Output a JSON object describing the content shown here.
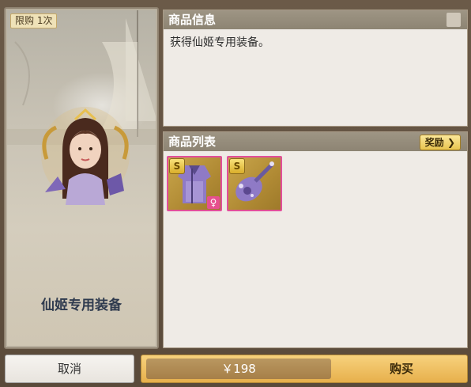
{
  "card": {
    "limit_tag": "限购 1次",
    "title": "仙姬专用装备"
  },
  "info_panel": {
    "header": "商品信息",
    "description": "获得仙姬专用装备。"
  },
  "list_panel": {
    "header": "商品列表",
    "reward_button": "奖励 ❯",
    "items": [
      {
        "icon": "robe-icon",
        "badge": "S",
        "gender_icon": "♀"
      },
      {
        "icon": "guitar-icon",
        "badge": "S"
      }
    ]
  },
  "footer": {
    "cancel_label": "取消",
    "price": "￥198",
    "buy_label": "购买"
  },
  "colors": {
    "item_border": "#e24e9a",
    "buy_button": "#e7b04c",
    "panel_header": "#9e9584"
  }
}
